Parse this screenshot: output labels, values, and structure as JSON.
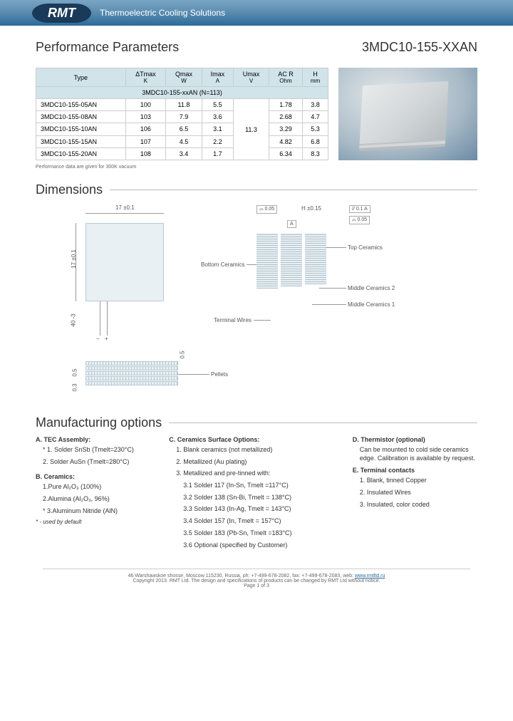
{
  "header": {
    "logo": "RMT",
    "tagline": "Thermoelectric Cooling Solutions"
  },
  "title": "Performance Parameters",
  "part_number": "3MDC10-155-XXAN",
  "table": {
    "headers": {
      "type": "Type",
      "dt": "ΔTmax",
      "dt_unit": "K",
      "q": "Qmax",
      "q_unit": "W",
      "i": "Imax",
      "i_unit": "A",
      "u": "Umax",
      "u_unit": "V",
      "acr": "AC R",
      "acr_unit": "Ohm",
      "h": "H",
      "h_unit": "mm"
    },
    "group": "3MDC10-155-xxAN (N=113)",
    "rows": [
      {
        "type": "3MDC10-155-05AN",
        "dt": "100",
        "q": "11.8",
        "i": "5.5",
        "u": "11.3",
        "acr": "1.78",
        "h": "3.8"
      },
      {
        "type": "3MDC10-155-08AN",
        "dt": "103",
        "q": "7.9",
        "i": "3.6",
        "u": "",
        "acr": "2.68",
        "h": "4.7"
      },
      {
        "type": "3MDC10-155-10AN",
        "dt": "106",
        "q": "6.5",
        "i": "3.1",
        "u": "",
        "acr": "3.29",
        "h": "5.3"
      },
      {
        "type": "3MDC10-155-15AN",
        "dt": "107",
        "q": "4.5",
        "i": "2.2",
        "u": "",
        "acr": "4.82",
        "h": "6.8"
      },
      {
        "type": "3MDC10-155-20AN",
        "dt": "108",
        "q": "3.4",
        "i": "1.7",
        "u": "",
        "acr": "6.34",
        "h": "8.3"
      }
    ],
    "footnote": "Performance data are given for 300K vacuum"
  },
  "dimensions": {
    "title": "Dimensions",
    "w": "17 ±0.1",
    "h": "17 ±0.1",
    "lead": "40 -3",
    "tol_box_a": "0.05",
    "tol_box_b": "0.1",
    "tol_box_c": "0.05",
    "datum_a": "A",
    "h_note": "H ±0.15",
    "label_top": "Top Ceramics",
    "label_bottom": "Bottom Ceramics",
    "label_mid1": "Middle Ceramics 1",
    "label_mid2": "Middle Ceramics 2",
    "label_wires": "Terminal Wires",
    "label_pellets": "Pellets",
    "gap_05a": "0.5",
    "gap_05b": "0.5",
    "gap_03": "0.3"
  },
  "mfg": {
    "title": "Manufacturing options",
    "a_title": "A. TEC Assembly:",
    "a1": "* 1. Solder SnSb (Tmelt=230°C)",
    "a2": "2. Solder AuSn (Tmelt=280°C)",
    "b_title": "B. Ceramics:",
    "b1": "1.Pure Al₂O₃ (100%)",
    "b2": "2.Alumina (Al₂O₃, 96%)",
    "b3": "* 3.Aluminum Nitride (AlN)",
    "note": "* - used by default",
    "c_title": "C. Ceramics Surface Options:",
    "c1": "1. Blank ceramics (not metallized)",
    "c2": "2. Metallized (Au plating)",
    "c3": "3. Metallized and pre-tinned with:",
    "c31": "3.1 Solder 117 (In-Sn, Tmelt =117°C)",
    "c32": "3.2 Solder 138 (Sn-Bi, Tmelt = 138°C)",
    "c33": "3.3 Solder 143 (In-Ag, Tmelt = 143°C)",
    "c34": "3.4 Solder 157 (In, Tmelt = 157°C)",
    "c35": "3.5 Solder 183 (Pb-Sn, Tmelt =183°C)",
    "c36": "3.6 Optional (specified by Customer)",
    "d_title": "D. Thermistor (optional)",
    "d1": "Can be mounted to cold side ceramics edge. Calibration is available by request.",
    "e_title": "E. Terminal contacts",
    "e1": "1. Blank, tinned Copper",
    "e2": "2. Insulated Wires",
    "e3": "3. Insulated, color coded"
  },
  "footer": {
    "addr": "46 Warshawskoe shosse, Moscow 115230, Russia, ph: +7-499-678-2082, fax: +7-499-678-2083, web: ",
    "link": "www.rmtltd.ru",
    "copy": "Copyright 2013. RMT Ltd. The design and specifications of products can be changed by RMT Ltd without notice.",
    "page": "Page 1 of 3"
  }
}
